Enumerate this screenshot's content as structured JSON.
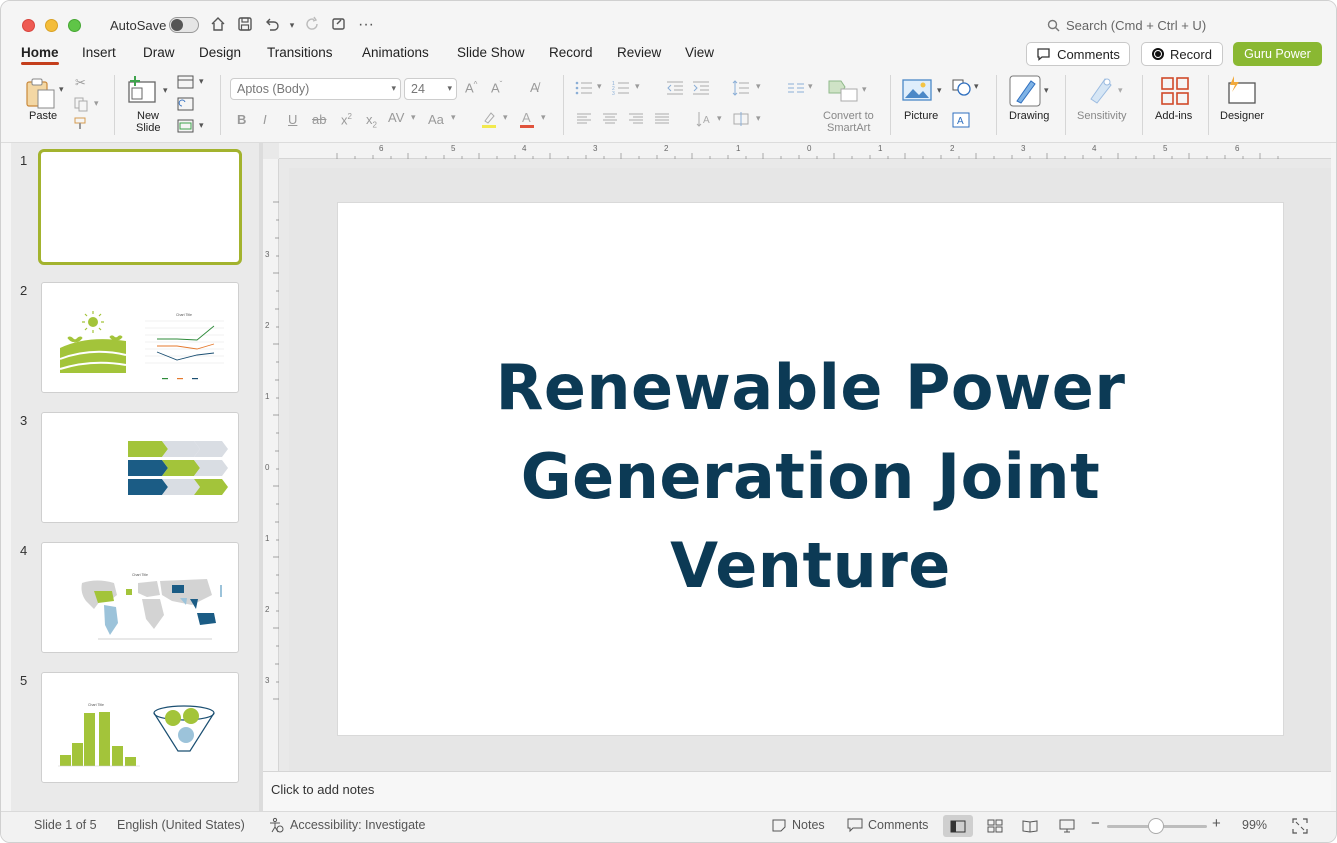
{
  "titlebar": {
    "autosave_label": "AutoSave",
    "search_placeholder": "Search (Cmd + Ctrl + U)"
  },
  "tabs": [
    {
      "label": "Home"
    },
    {
      "label": "Insert"
    },
    {
      "label": "Draw"
    },
    {
      "label": "Design"
    },
    {
      "label": "Transitions"
    },
    {
      "label": "Animations"
    },
    {
      "label": "Slide Show"
    },
    {
      "label": "Record"
    },
    {
      "label": "Review"
    },
    {
      "label": "View"
    }
  ],
  "header_buttons": {
    "comments": "Comments",
    "record": "Record",
    "guru": "Guru Power"
  },
  "ribbon": {
    "paste": "Paste",
    "new_slide_1": "New",
    "new_slide_2": "Slide",
    "font_name": "Aptos (Body)",
    "font_size": "24",
    "convert_1": "Convert to",
    "convert_2": "SmartArt",
    "picture": "Picture",
    "drawing": "Drawing",
    "sensitivity": "Sensitivity",
    "addins": "Add-ins",
    "designer": "Designer"
  },
  "ruler": {
    "h_ticks": [
      "6",
      "5",
      "4",
      "3",
      "2",
      "1",
      "0",
      "1",
      "2",
      "3",
      "4",
      "5",
      "6"
    ],
    "v_ticks": [
      "3",
      "2",
      "1",
      "0",
      "1",
      "2",
      "3"
    ]
  },
  "thumbnails": [
    {
      "num": "1"
    },
    {
      "num": "2",
      "chart_title": "Chart Title"
    },
    {
      "num": "3"
    },
    {
      "num": "4",
      "chart_title": "Chart Title"
    },
    {
      "num": "5",
      "chart_title": "Chart Title"
    }
  ],
  "slide": {
    "title_line1": "Renewable Power",
    "title_line2": "Generation Joint",
    "title_line3": "Venture"
  },
  "notes": {
    "placeholder": "Click to add notes"
  },
  "status": {
    "slide_count": "Slide 1 of 5",
    "language": "English (United States)",
    "accessibility": "Accessibility: Investigate",
    "notes": "Notes",
    "comments": "Comments",
    "zoom": "99%"
  },
  "colors": {
    "accent_green": "#a3c43a",
    "accent_navy": "#1b4f72",
    "title_navy": "#0c3a55",
    "tab_underline": "#c43e1c",
    "guru_button": "#8ab832"
  }
}
